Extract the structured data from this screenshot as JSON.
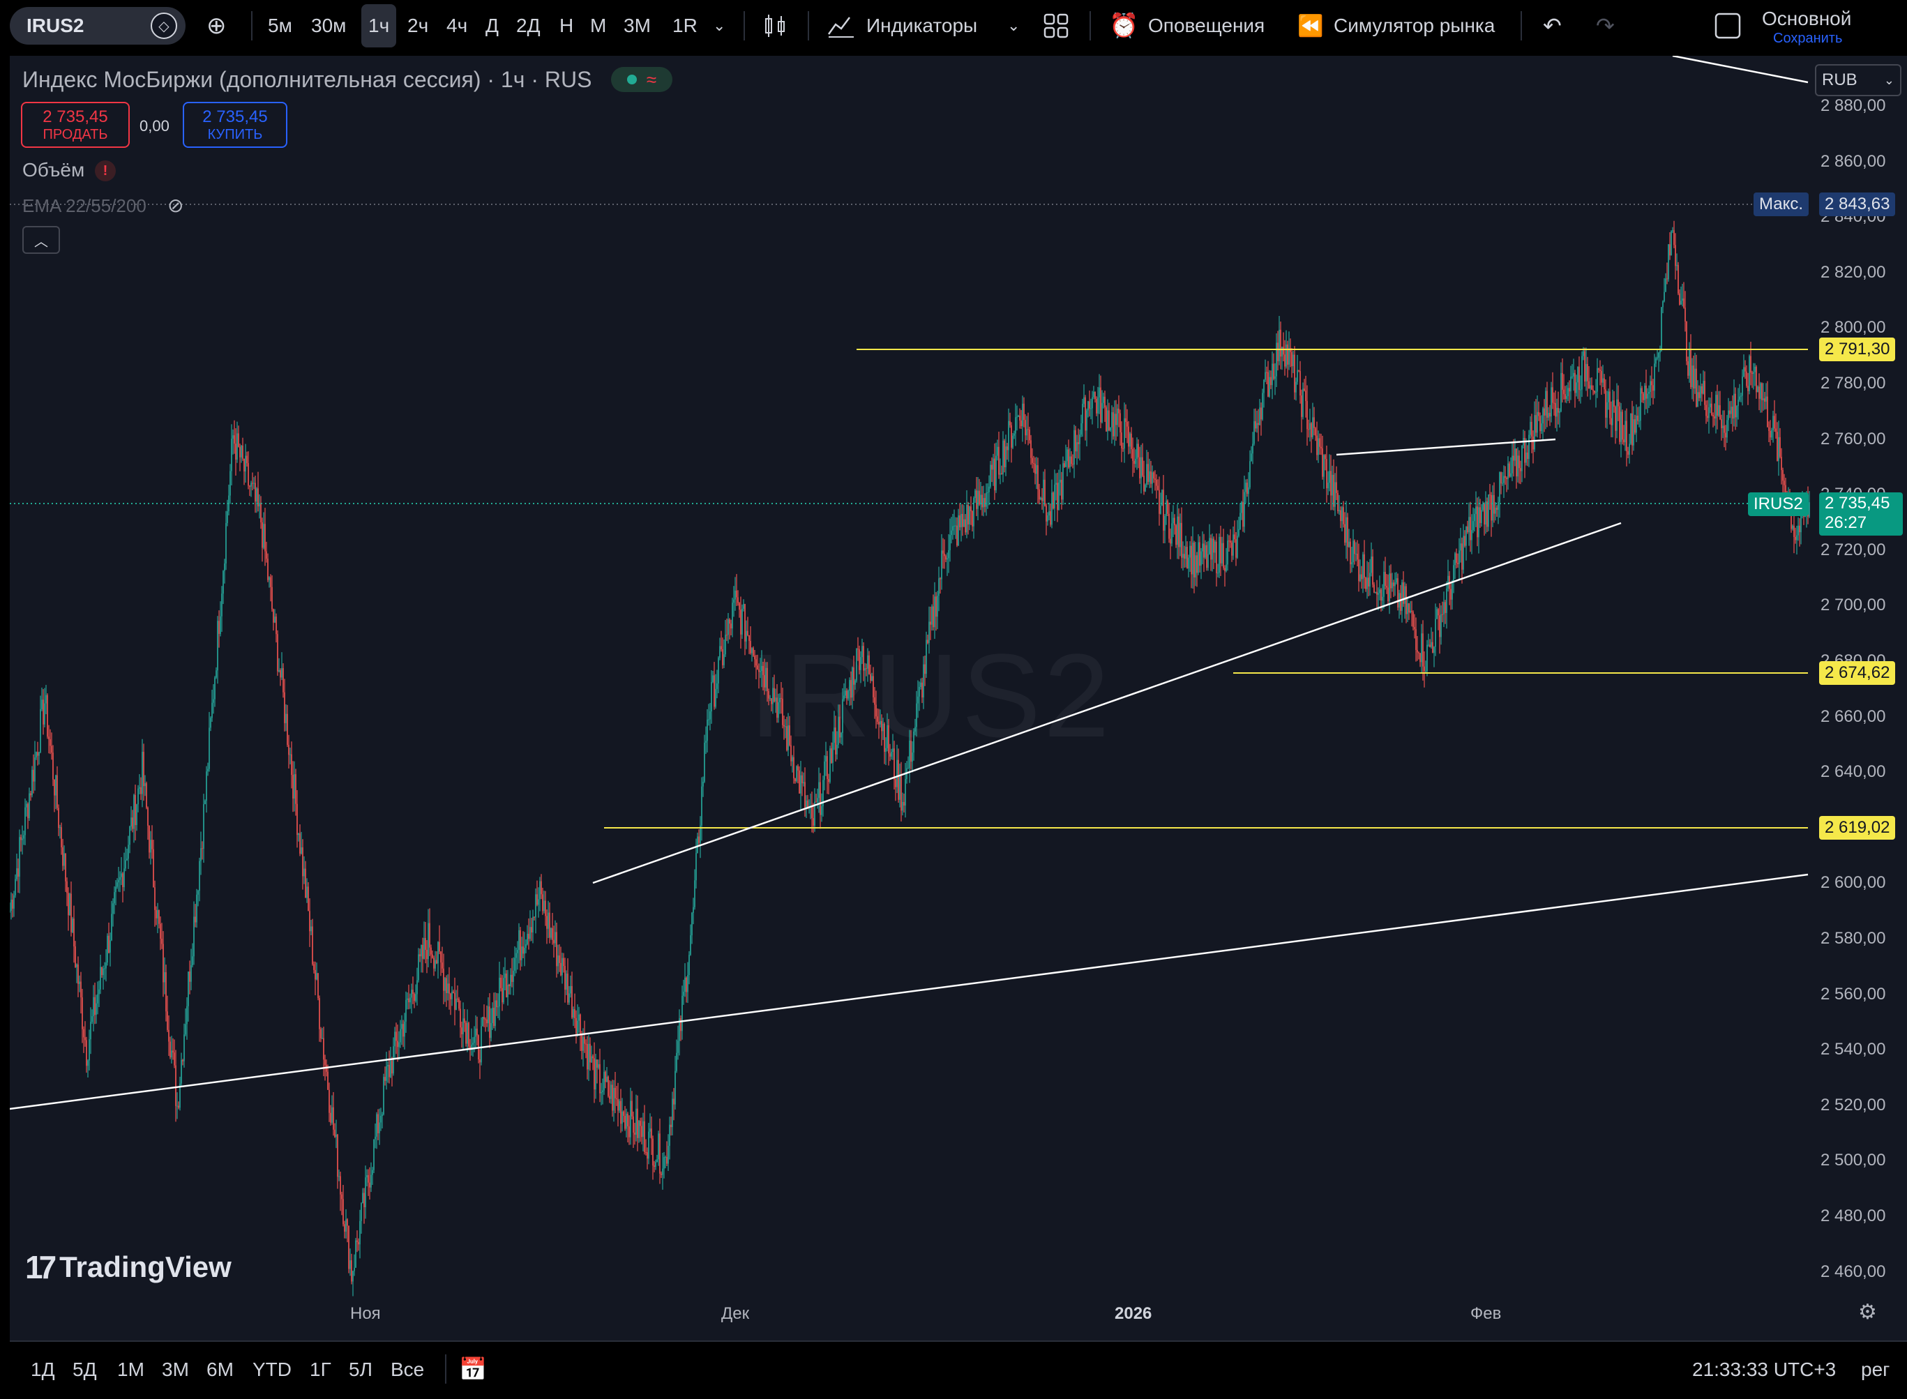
{
  "toolbar": {
    "symbol": "IRUS2",
    "intervals": [
      "5м",
      "30м",
      "1ч",
      "2ч",
      "4ч",
      "Д",
      "2Д",
      "Н",
      "М",
      "3М",
      "1R"
    ],
    "active_interval": "1ч",
    "indicators_label": "Индикаторы",
    "alerts_label": "Оповещения",
    "replay_label": "Симулятор рынка",
    "layout_name": "Основной",
    "layout_save": "Сохранить"
  },
  "legend": {
    "title": "Индекс МосБиржи (дополнительная сессия) · 1ч · RUS",
    "sell_price": "2 735,45",
    "sell_label": "ПРОДАТЬ",
    "spread": "0,00",
    "buy_price": "2 735,45",
    "buy_label": "КУПИТЬ",
    "volume_label": "Объём",
    "volume_warning": "!",
    "ema_label": "EMA 22/55/200"
  },
  "watermark": "IRUS2",
  "brand": "TradingView",
  "currency": "RUB",
  "price_scale": {
    "ticks": [
      "2 880,00",
      "2 860,00",
      "2 840,00",
      "2 820,00",
      "2 800,00",
      "2 780,00",
      "2 760,00",
      "2 740,00",
      "2 720,00",
      "2 700,00",
      "2 680,00",
      "2 660,00",
      "2 640,00",
      "2 620,00",
      "2 600,00",
      "2 580,00",
      "2 560,00",
      "2 540,00",
      "2 520,00",
      "2 500,00",
      "2 480,00",
      "2 460,00"
    ],
    "max_label": "Макс.",
    "max_value": "2 843,63",
    "levels": [
      "2 791,30",
      "2 674,62",
      "2 619,02"
    ],
    "current_symbol": "IRUS2",
    "current_price": "2 735,45",
    "countdown": "26:27"
  },
  "time_scale": {
    "ticks": [
      "Ноя",
      "Дек",
      "2026",
      "Фев"
    ]
  },
  "bottom": {
    "ranges": [
      "1Д",
      "5Д",
      "1М",
      "3М",
      "6М",
      "YTD",
      "1Г",
      "5Л",
      "Все"
    ],
    "clock": "21:33:33 UTC+3",
    "adj": "рег"
  },
  "colors": {
    "up": "#26a69a",
    "down": "#ef5350",
    "level": "#f5e84a",
    "trendline": "#ffffff",
    "background": "#131722"
  },
  "chart_data": {
    "type": "candlestick",
    "y_range": [
      2450,
      2890
    ],
    "x_ticks": [
      "Ноя",
      "Дек",
      "2026",
      "Фев"
    ],
    "anchors": [
      [
        0,
        2590
      ],
      [
        25,
        2665
      ],
      [
        55,
        2540
      ],
      [
        95,
        2640
      ],
      [
        120,
        2520
      ],
      [
        140,
        2630
      ],
      [
        160,
        2760
      ],
      [
        180,
        2730
      ],
      [
        200,
        2650
      ],
      [
        225,
        2540
      ],
      [
        245,
        2460
      ],
      [
        270,
        2530
      ],
      [
        300,
        2580
      ],
      [
        335,
        2540
      ],
      [
        380,
        2595
      ],
      [
        420,
        2530
      ],
      [
        470,
        2500
      ],
      [
        490,
        2590
      ],
      [
        500,
        2660
      ],
      [
        520,
        2700
      ],
      [
        550,
        2665
      ],
      [
        575,
        2620
      ],
      [
        610,
        2685
      ],
      [
        640,
        2630
      ],
      [
        670,
        2720
      ],
      [
        700,
        2740
      ],
      [
        725,
        2770
      ],
      [
        745,
        2730
      ],
      [
        775,
        2775
      ],
      [
        800,
        2760
      ],
      [
        830,
        2730
      ],
      [
        850,
        2715
      ],
      [
        880,
        2720
      ],
      [
        895,
        2770
      ],
      [
        912,
        2795
      ],
      [
        935,
        2760
      ],
      [
        965,
        2715
      ],
      [
        1000,
        2700
      ],
      [
        1015,
        2680
      ],
      [
        1045,
        2725
      ],
      [
        1075,
        2745
      ],
      [
        1100,
        2770
      ],
      [
        1130,
        2785
      ],
      [
        1160,
        2760
      ],
      [
        1180,
        2785
      ],
      [
        1192,
        2835
      ],
      [
        1205,
        2780
      ],
      [
        1230,
        2765
      ],
      [
        1250,
        2785
      ],
      [
        1265,
        2760
      ],
      [
        1280,
        2725
      ],
      [
        1290,
        2735
      ]
    ]
  }
}
